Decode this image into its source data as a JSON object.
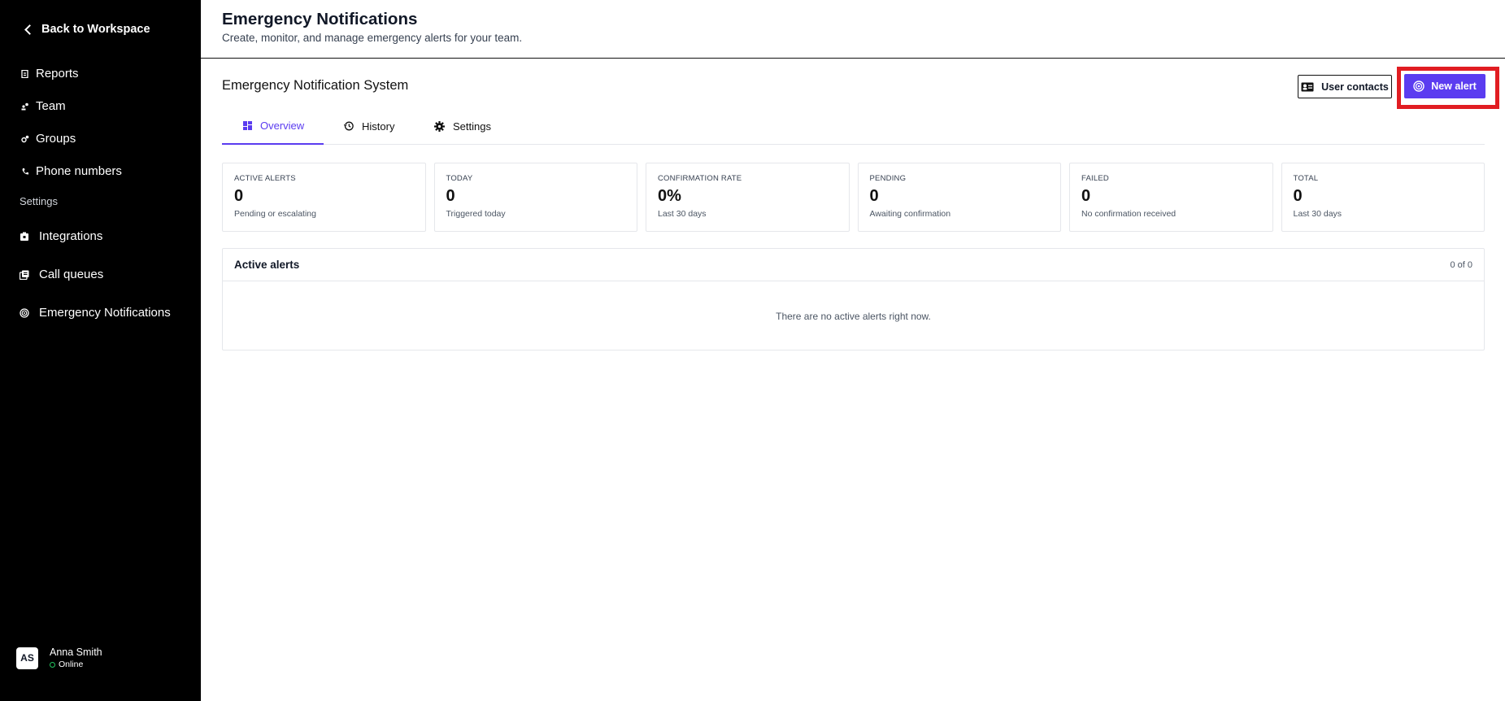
{
  "sidebar": {
    "back_label": "Back to Workspace",
    "items": [
      {
        "label": "Reports",
        "icon": "report-icon"
      },
      {
        "label": "Team",
        "icon": "team-icon"
      },
      {
        "label": "Groups",
        "icon": "groups-icon"
      },
      {
        "label": "Phone numbers",
        "icon": "phone-icon"
      }
    ],
    "settings_label": "Settings",
    "settings_items": [
      {
        "label": "Integrations",
        "icon": "integrations-icon"
      },
      {
        "label": "Call queues",
        "icon": "call-queues-icon"
      },
      {
        "label": "Emergency Notifications",
        "icon": "emergency-icon"
      }
    ],
    "user": {
      "initials": "AS",
      "name": "Anna Smith",
      "status": "Online"
    }
  },
  "header": {
    "title": "Emergency Notifications",
    "subtitle": "Create, monitor, and manage emergency alerts for your team."
  },
  "main": {
    "system_title": "Emergency Notification System",
    "buttons": {
      "user_contacts": "User contacts",
      "new_alert": "New alert"
    },
    "tabs": [
      {
        "label": "Overview",
        "icon": "dashboard-icon",
        "active": true
      },
      {
        "label": "History",
        "icon": "history-icon",
        "active": false
      },
      {
        "label": "Settings",
        "icon": "gear-icon",
        "active": false
      }
    ],
    "stats": [
      {
        "label": "ACTIVE ALERTS",
        "value": "0",
        "sub": "Pending or escalating"
      },
      {
        "label": "TODAY",
        "value": "0",
        "sub": "Triggered today"
      },
      {
        "label": "CONFIRMATION RATE",
        "value": "0%",
        "sub": "Last 30 days"
      },
      {
        "label": "PENDING",
        "value": "0",
        "sub": "Awaiting confirmation"
      },
      {
        "label": "FAILED",
        "value": "0",
        "sub": "No confirmation received"
      },
      {
        "label": "TOTAL",
        "value": "0",
        "sub": "Last 30 days"
      }
    ],
    "active_alerts": {
      "title": "Active alerts",
      "count": "0 of 0",
      "empty_message": "There are no active alerts right now."
    }
  },
  "colors": {
    "accent": "#5b3cf0",
    "sidebar_bg": "#000000",
    "highlight": "#e11d22",
    "online": "#22c55e"
  }
}
